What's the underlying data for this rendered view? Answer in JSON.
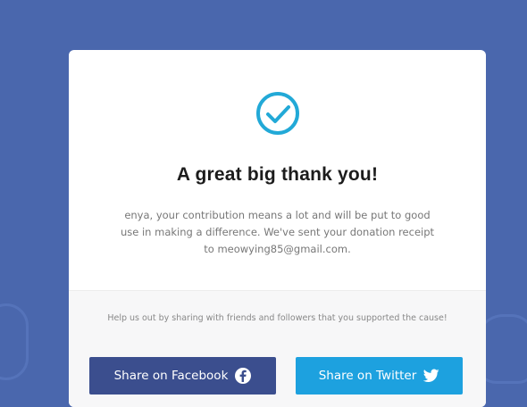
{
  "modal": {
    "headline": "A great big thank you!",
    "message": "enya, your contribution means a lot and will be put to good use in making a difference. We've sent your donation receipt to meowying85@gmail.com.",
    "share_note": "Help us out by sharing with friends and followers that you supported the cause!",
    "facebook_button": "Share on Facebook",
    "twitter_button": "Share on Twitter",
    "check_icon": "check-circle-icon",
    "facebook_icon": "facebook-icon",
    "twitter_icon": "twitter-bird-icon"
  },
  "colors": {
    "background": "#4a67ad",
    "accent": "#22a9d7",
    "facebook": "#3b4e8e",
    "twitter": "#1da1df"
  }
}
